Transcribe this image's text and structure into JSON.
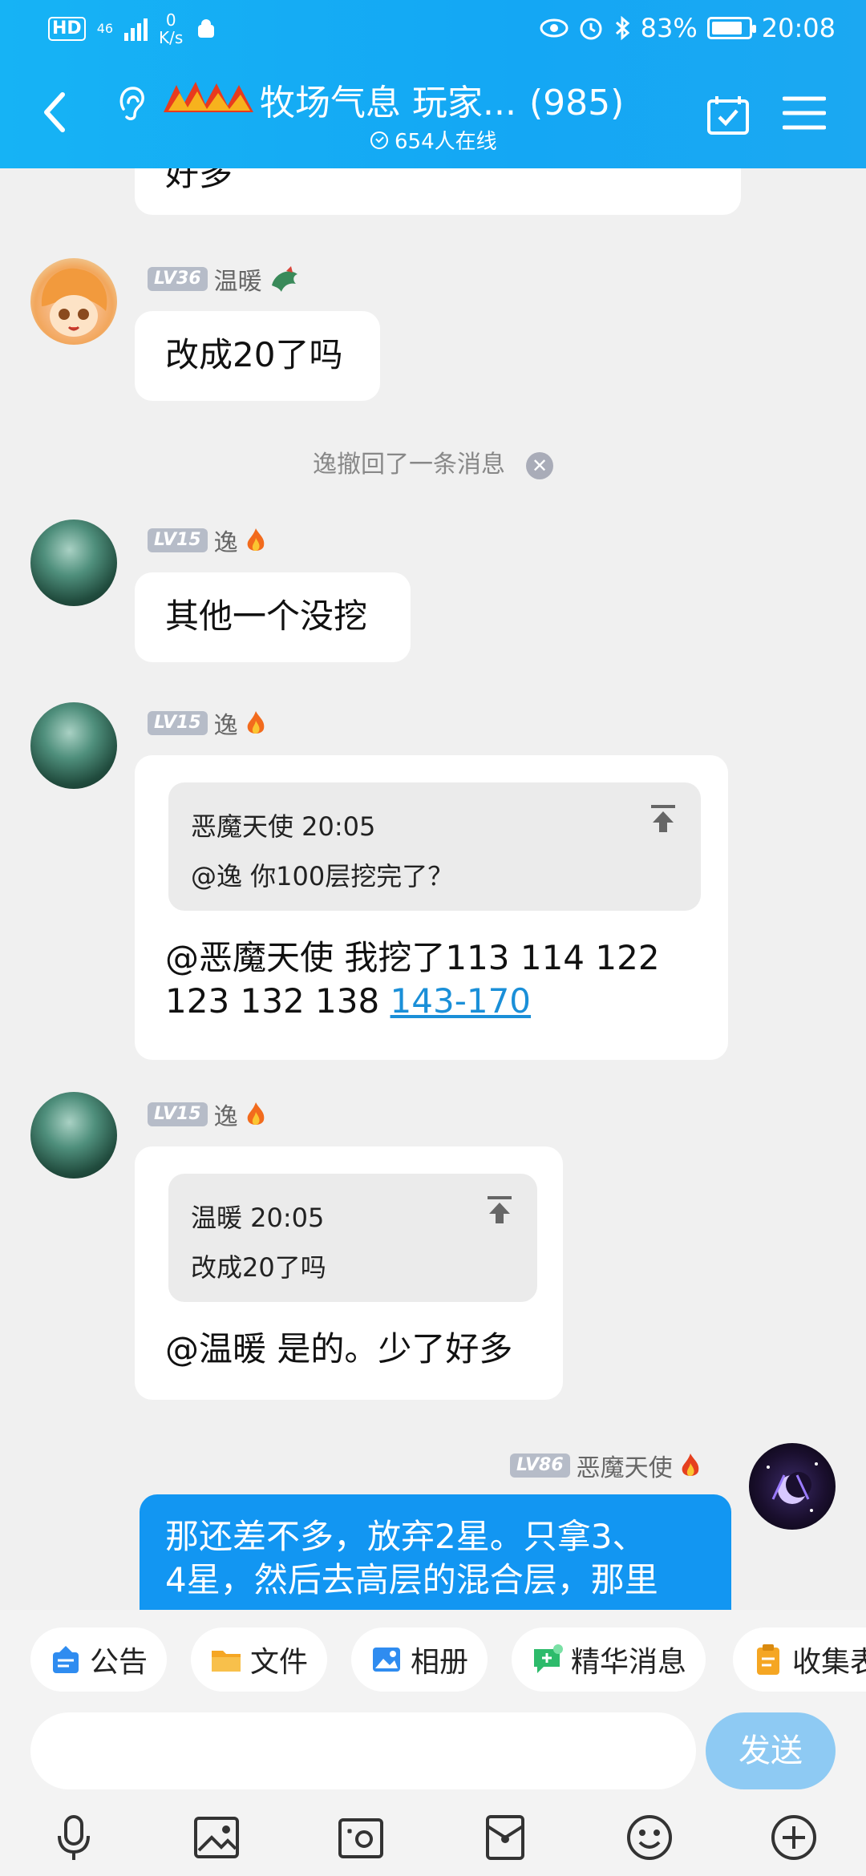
{
  "status": {
    "hd": "HD",
    "network": "46",
    "speed_value": "0",
    "speed_unit": "K/s",
    "battery": "83%",
    "battery_level": 0.83,
    "time": "20:08"
  },
  "header": {
    "title": "牧场气息 玩家...",
    "member_count": "(985)",
    "online": "654人在线"
  },
  "messages": {
    "partial_text": "好多",
    "m1": {
      "level": "LV36",
      "name": "温暖",
      "text": "改成20了吗"
    },
    "recall": "逸撤回了一条消息",
    "m2": {
      "level": "LV15",
      "name": "逸",
      "text": "其他一个没挖"
    },
    "m3": {
      "level": "LV15",
      "name": "逸",
      "quote_head": "恶魔天使 20:05",
      "quote_text": "@逸 你100层挖完了？",
      "line1": "@恶魔天使 我挖了113 114 122",
      "line2_prefix": "123 132 138 ",
      "link": "143-170"
    },
    "m4": {
      "level": "LV15",
      "name": "逸",
      "quote_head": "温暖 20:05",
      "quote_text": "改成20了吗",
      "text": "@温暖 是的。少了好多"
    },
    "m5": {
      "level": "LV86",
      "name": "恶魔天使",
      "line1": "那还差不多，放弃2星。只拿3、",
      "line2": "4星，然后去高层的混合层，那里"
    }
  },
  "shortcuts": {
    "announce": "公告",
    "files": "文件",
    "album": "相册",
    "essence": "精华消息",
    "collect": "收集表"
  },
  "input": {
    "placeholder": "",
    "send": "发送"
  },
  "colors": {
    "header": "#14a7f4",
    "self_bubble": "#1296f2",
    "link": "#1a8fd8"
  }
}
